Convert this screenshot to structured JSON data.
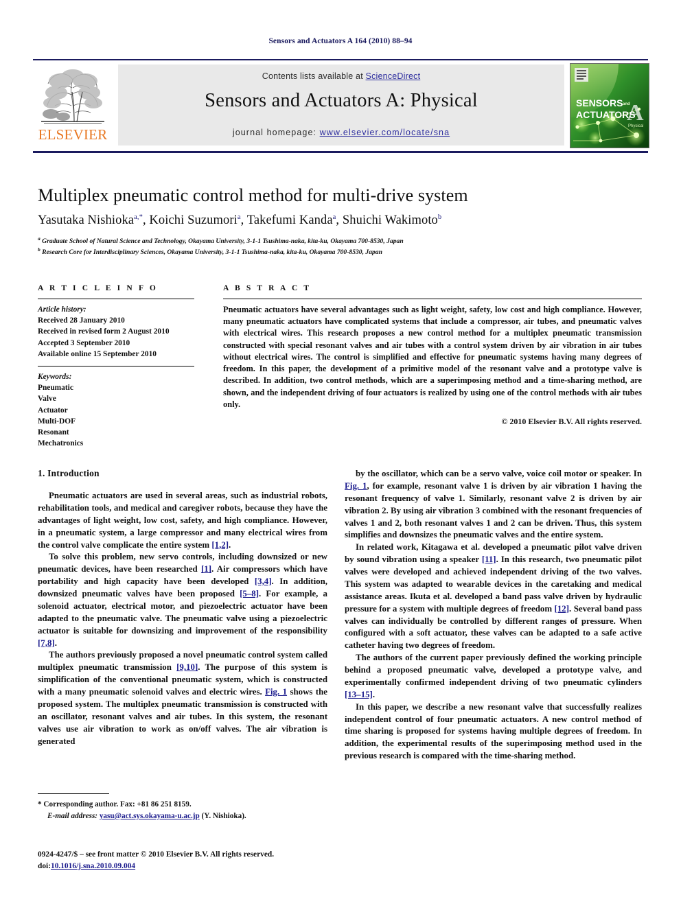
{
  "running_head": "Sensors and Actuators A 164 (2010) 88–94",
  "masthead": {
    "contents_prefix": "Contents lists available at ",
    "sciencedirect": "ScienceDirect",
    "journal_title": "Sensors and Actuators A: Physical",
    "homepage_prefix": "journal homepage:",
    "homepage_url": "www.elsevier.com/locate/sna",
    "publisher_wordmark": "ELSEVIER",
    "publisher_logo": "elsevier-tree-logo",
    "cover": {
      "line1": "SENSORS",
      "line1_suffix": "and",
      "line2": "ACTUATORS",
      "letter": "A",
      "sublabel": "Physical"
    },
    "colors": {
      "rule": "#1a1a5e",
      "band": "#e9e9e9",
      "link": "#2d2d9e",
      "elsevier_orange": "#e87722",
      "cover_green": "#3f9c35"
    }
  },
  "title": "Multiplex pneumatic control method for multi-drive system",
  "authors": [
    {
      "name": "Yasutaka Nishioka",
      "marks": "a,*"
    },
    {
      "name": "Koichi Suzumori",
      "marks": "a"
    },
    {
      "name": "Takefumi Kanda",
      "marks": "a"
    },
    {
      "name": "Shuichi Wakimoto",
      "marks": "b"
    }
  ],
  "affiliations": [
    {
      "mark": "a",
      "text": "Graduate School of Natural Science and Technology, Okayama University, 3-1-1 Tsushima-naka, kita-ku, Okayama 700-8530, Japan"
    },
    {
      "mark": "b",
      "text": "Research Core for Interdisciplinary Sciences, Okayama University, 3-1-1 Tsushima-naka, kita-ku, Okayama 700-8530, Japan"
    }
  ],
  "article_info": {
    "heading": "A R T I C L E  I N F O",
    "history_label": "Article history:",
    "history": [
      "Received 28 January 2010",
      "Received in revised form 2 August 2010",
      "Accepted 3 September 2010",
      "Available online 15 September 2010"
    ],
    "keywords_label": "Keywords:",
    "keywords": [
      "Pneumatic",
      "Valve",
      "Actuator",
      "Multi-DOF",
      "Resonant",
      "Mechatronics"
    ]
  },
  "abstract": {
    "heading": "A B S T R A C T",
    "text": "Pneumatic actuators have several advantages such as light weight, safety, low cost and high compliance. However, many pneumatic actuators have complicated systems that include a compressor, air tubes, and pneumatic valves with electrical wires. This research proposes a new control method for a multiplex pneumatic transmission constructed with special resonant valves and air tubes with a control system driven by air vibration in air tubes without electrical wires. The control is simplified and effective for pneumatic systems having many degrees of freedom. In this paper, the development of a primitive model of the resonant valve and a prototype valve is described. In addition, two control methods, which are a superimposing method and a time-sharing method, are shown, and the independent driving of four actuators is realized by using one of the control methods with air tubes only.",
    "copyright": "© 2010 Elsevier B.V. All rights reserved."
  },
  "sections": {
    "intro_heading": "1. Introduction"
  },
  "body_left": [
    {
      "id": "p1",
      "segments": [
        {
          "t": "Pneumatic actuators are used in several areas, such as industrial robots, rehabilitation tools, and medical and caregiver robots, because they have the advantages of light weight, low cost, safety, and high compliance. However, in a pneumatic system, a large compressor and many electrical wires from the control valve complicate the entire system ",
          "k": "n"
        },
        {
          "t": "[1,2]",
          "k": "r"
        },
        {
          "t": ".",
          "k": "n"
        }
      ]
    },
    {
      "id": "p2",
      "segments": [
        {
          "t": "To solve this problem, new servo controls, including downsized or new pneumatic devices, have been researched ",
          "k": "n"
        },
        {
          "t": "[1]",
          "k": "r"
        },
        {
          "t": ". Air compressors which have portability and high capacity have been developed ",
          "k": "n"
        },
        {
          "t": "[3,4]",
          "k": "r"
        },
        {
          "t": ". In addition, downsized pneumatic valves have been proposed ",
          "k": "n"
        },
        {
          "t": "[5–8]",
          "k": "r"
        },
        {
          "t": ". For example, a solenoid actuator, electrical motor, and piezoelectric actuator have been adapted to the pneumatic valve. The pneumatic valve using a piezoelectric actuator is suitable for downsizing and improvement of the responsibility ",
          "k": "n"
        },
        {
          "t": "[7,8]",
          "k": "r"
        },
        {
          "t": ".",
          "k": "n"
        }
      ]
    },
    {
      "id": "p3",
      "segments": [
        {
          "t": "The authors previously proposed a novel pneumatic control system called multiplex pneumatic transmission ",
          "k": "n"
        },
        {
          "t": "[9,10]",
          "k": "r"
        },
        {
          "t": ". The purpose of this system is simplification of the conventional pneumatic system, which is constructed with a many pneumatic solenoid valves and electric wires. ",
          "k": "n"
        },
        {
          "t": "Fig. 1",
          "k": "r"
        },
        {
          "t": " shows the proposed system. The multiplex pneumatic transmission is constructed with an oscillator, resonant valves and air tubes. In this system, the resonant valves use air vibration to work as on/off valves. The air vibration is generated",
          "k": "n"
        }
      ]
    }
  ],
  "body_right": [
    {
      "id": "p4",
      "segments": [
        {
          "t": "by the oscillator, which can be a servo valve, voice coil motor or speaker. In ",
          "k": "n"
        },
        {
          "t": "Fig. 1",
          "k": "r"
        },
        {
          "t": ", for example, resonant valve 1 is driven by air vibration 1 having the resonant frequency of valve 1. Similarly, resonant valve 2 is driven by air vibration 2. By using air vibration 3 combined with the resonant frequencies of valves 1 and 2, both resonant valves 1 and 2 can be driven. Thus, this system simplifies and downsizes the pneumatic valves and the entire system.",
          "k": "n"
        }
      ]
    },
    {
      "id": "p5",
      "segments": [
        {
          "t": "In related work, Kitagawa et al. developed a pneumatic pilot valve driven by sound vibration using a speaker ",
          "k": "n"
        },
        {
          "t": "[11]",
          "k": "r"
        },
        {
          "t": ". In this research, two pneumatic pilot valves were developed and achieved independent driving of the two valves. This system was adapted to wearable devices in the caretaking and medical assistance areas. Ikuta et al. developed a band pass valve driven by hydraulic pressure for a system with multiple degrees of freedom ",
          "k": "n"
        },
        {
          "t": "[12]",
          "k": "r"
        },
        {
          "t": ". Several band pass valves can individually be controlled by different ranges of pressure. When configured with a soft actuator, these valves can be adapted to a safe active catheter having two degrees of freedom.",
          "k": "n"
        }
      ]
    },
    {
      "id": "p6",
      "segments": [
        {
          "t": "The authors of the current paper previously defined the working principle behind a proposed pneumatic valve, developed a prototype valve, and experimentally confirmed independent driving of two pneumatic cylinders ",
          "k": "n"
        },
        {
          "t": "[13–15]",
          "k": "r"
        },
        {
          "t": ".",
          "k": "n"
        }
      ]
    },
    {
      "id": "p7",
      "segments": [
        {
          "t": "In this paper, we describe a new resonant valve that successfully realizes independent control of four pneumatic actuators. A new control method of time sharing is proposed for systems having multiple degrees of freedom. In addition, the experimental results of the superimposing method used in the previous research is compared with the time-sharing method.",
          "k": "n"
        }
      ]
    }
  ],
  "footnote": {
    "corresponding": "* Corresponding author. Fax: +81 86 251 8159.",
    "email_label": "E-mail address:",
    "email": "yasu@act.sys.okayama-u.ac.jp",
    "email_suffix": "(Y. Nishioka)."
  },
  "imprint": {
    "line1": "0924-4247/$ – see front matter © 2010 Elsevier B.V. All rights reserved.",
    "doi_label": "doi:",
    "doi_value": "10.1016/j.sna.2010.09.004"
  }
}
